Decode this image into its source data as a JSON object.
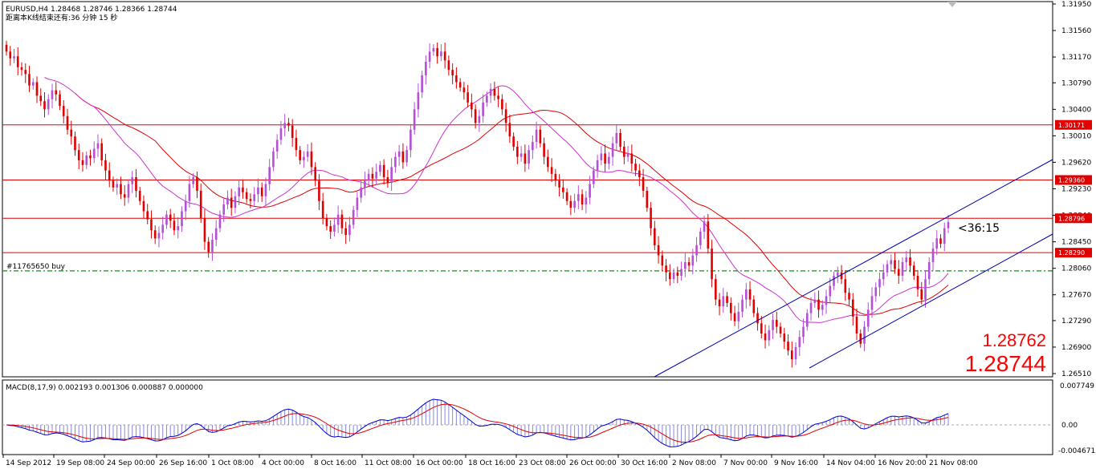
{
  "header": {
    "symbol_line": "EURUSD,H4  1.28468 1.28746 1.28366 1.28744",
    "countdown_line": "距离本K线结束还有:36 分钟 15 秒"
  },
  "timer_label": "<36:15",
  "order_label": "#11765650 buy",
  "price_display": {
    "bid": "1.28762",
    "ask": "1.28744"
  },
  "macd": {
    "header": "MACD(8,17,9) 0.002193 0.001306 0.000887 0.000000",
    "axis_ticks": [
      "0.007749",
      "0.00",
      "-0.004671"
    ]
  },
  "colors": {
    "bull": "#b44fd6",
    "bear": "#e00000",
    "ma_red": "#e00000",
    "ma_magenta": "#cc33cc",
    "channel": "#0000aa",
    "level": "#e00000",
    "order_line": "#009900",
    "macd_line": "#0000cc",
    "signal_line": "#e00000",
    "histogram": "#8888dd"
  },
  "chart_data": {
    "type": "candlestick",
    "symbol": "EURUSD",
    "timeframe": "H4",
    "ylim": [
      1.2651,
      1.3195
    ],
    "y_ticks": [
      "1.31950",
      "1.31560",
      "1.31170",
      "1.30790",
      "1.30400",
      "1.30010",
      "1.29620",
      "1.29230",
      "1.28840",
      "1.28450",
      "1.28060",
      "1.27670",
      "1.27290",
      "1.26900",
      "1.26510"
    ],
    "x_ticks": [
      "14 Sep 2012",
      "19 Sep 08:00",
      "24 Sep 00:00",
      "26 Sep 16:00",
      "1 Oct 08:00",
      "4 Oct 00:00",
      "8 Oct 16:00",
      "11 Oct 08:00",
      "16 Oct 00:00",
      "18 Oct 16:00",
      "23 Oct 08:00",
      "26 Oct 00:00",
      "30 Oct 16:00",
      "2 Nov 08:00",
      "7 Nov 00:00",
      "9 Nov 16:00",
      "14 Nov 04:00",
      "16 Nov 20:00",
      "21 Nov 08:00"
    ],
    "levels": [
      {
        "price": 1.30171,
        "label": "1.30171"
      },
      {
        "price": 1.2936,
        "label": "1.29360"
      },
      {
        "price": 1.28796,
        "label": "1.28796"
      },
      {
        "price": 1.2829,
        "label": "1.28290"
      }
    ],
    "order_level": 1.28022,
    "close_series": [
      1.3125,
      1.3115,
      1.3118,
      1.3102,
      1.3098,
      1.3092,
      1.3075,
      1.308,
      1.306,
      1.3052,
      1.304,
      1.3055,
      1.3068,
      1.3062,
      1.3045,
      1.303,
      1.301,
      1.3,
      1.298,
      1.2965,
      1.2958,
      1.2972,
      1.2968,
      1.2982,
      1.299,
      1.2965,
      1.295,
      1.2935,
      1.2925,
      1.293,
      1.2915,
      1.291,
      1.293,
      1.294,
      1.292,
      1.2905,
      1.289,
      1.2878,
      1.2862,
      1.285,
      1.2858,
      1.287,
      1.2885,
      1.2876,
      1.2862,
      1.2868,
      1.289,
      1.2905,
      1.293,
      1.294,
      1.292,
      1.288,
      1.2845,
      1.283,
      1.2848,
      1.2865,
      1.2885,
      1.29,
      1.291,
      1.2895,
      1.2912,
      1.2925,
      1.2918,
      1.2908,
      1.2905,
      1.2915,
      1.2925,
      1.2912,
      1.293,
      1.2955,
      1.2978,
      1.2995,
      1.3012,
      1.302,
      1.3016,
      1.2998,
      1.298,
      1.2965,
      1.297,
      1.2978,
      1.2955,
      1.2935,
      1.2905,
      1.288,
      1.2868,
      1.286,
      1.287,
      1.2885,
      1.2865,
      1.2855,
      1.287,
      1.2892,
      1.291,
      1.2925,
      1.2935,
      1.2945,
      1.2938,
      1.2948,
      1.2958,
      1.294,
      1.2932,
      1.2955,
      1.297,
      1.2978,
      1.2962,
      1.298,
      1.301,
      1.304,
      1.3065,
      1.309,
      1.311,
      1.3125,
      1.313,
      1.3118,
      1.3125,
      1.3112,
      1.3098,
      1.309,
      1.308,
      1.3072,
      1.3065,
      1.305,
      1.304,
      1.302,
      1.303,
      1.305,
      1.306,
      1.307,
      1.306,
      1.3055,
      1.304,
      1.302,
      1.3,
      1.2985,
      1.297,
      1.2975,
      1.296,
      1.298,
      1.2992,
      1.301,
      1.299,
      1.297,
      1.2955,
      1.2945,
      1.2935,
      1.2925,
      1.2918,
      1.2905,
      1.2895,
      1.2905,
      1.2915,
      1.29,
      1.291,
      1.293,
      1.295,
      1.2965,
      1.2975,
      1.296,
      1.297,
      1.299,
      1.3005,
      1.2985,
      1.297,
      1.2975,
      1.296,
      1.295,
      1.294,
      1.292,
      1.2895,
      1.2865,
      1.284,
      1.2825,
      1.281,
      1.28,
      1.279,
      1.28,
      1.2795,
      1.2805,
      1.2815,
      1.281,
      1.2825,
      1.284,
      1.286,
      1.2875,
      1.2835,
      1.279,
      1.276,
      1.275,
      1.2765,
      1.2755,
      1.274,
      1.2728,
      1.2742,
      1.276,
      1.2775,
      1.276,
      1.274,
      1.2725,
      1.271,
      1.27,
      1.2715,
      1.273,
      1.272,
      1.271,
      1.2698,
      1.2685,
      1.2672,
      1.269,
      1.2705,
      1.272,
      1.274,
      1.2755,
      1.276,
      1.2745,
      1.2752,
      1.2765,
      1.278,
      1.2795,
      1.28,
      1.279,
      1.277,
      1.276,
      1.2735,
      1.271,
      1.2695,
      1.272,
      1.2745,
      1.2765,
      1.2778,
      1.279,
      1.28,
      1.2812,
      1.2818,
      1.2805,
      1.2795,
      1.2815,
      1.2822,
      1.281,
      1.2795,
      1.2775,
      1.276,
      1.279,
      1.2815,
      1.2835,
      1.285,
      1.2842,
      1.2865,
      1.2874
    ]
  }
}
